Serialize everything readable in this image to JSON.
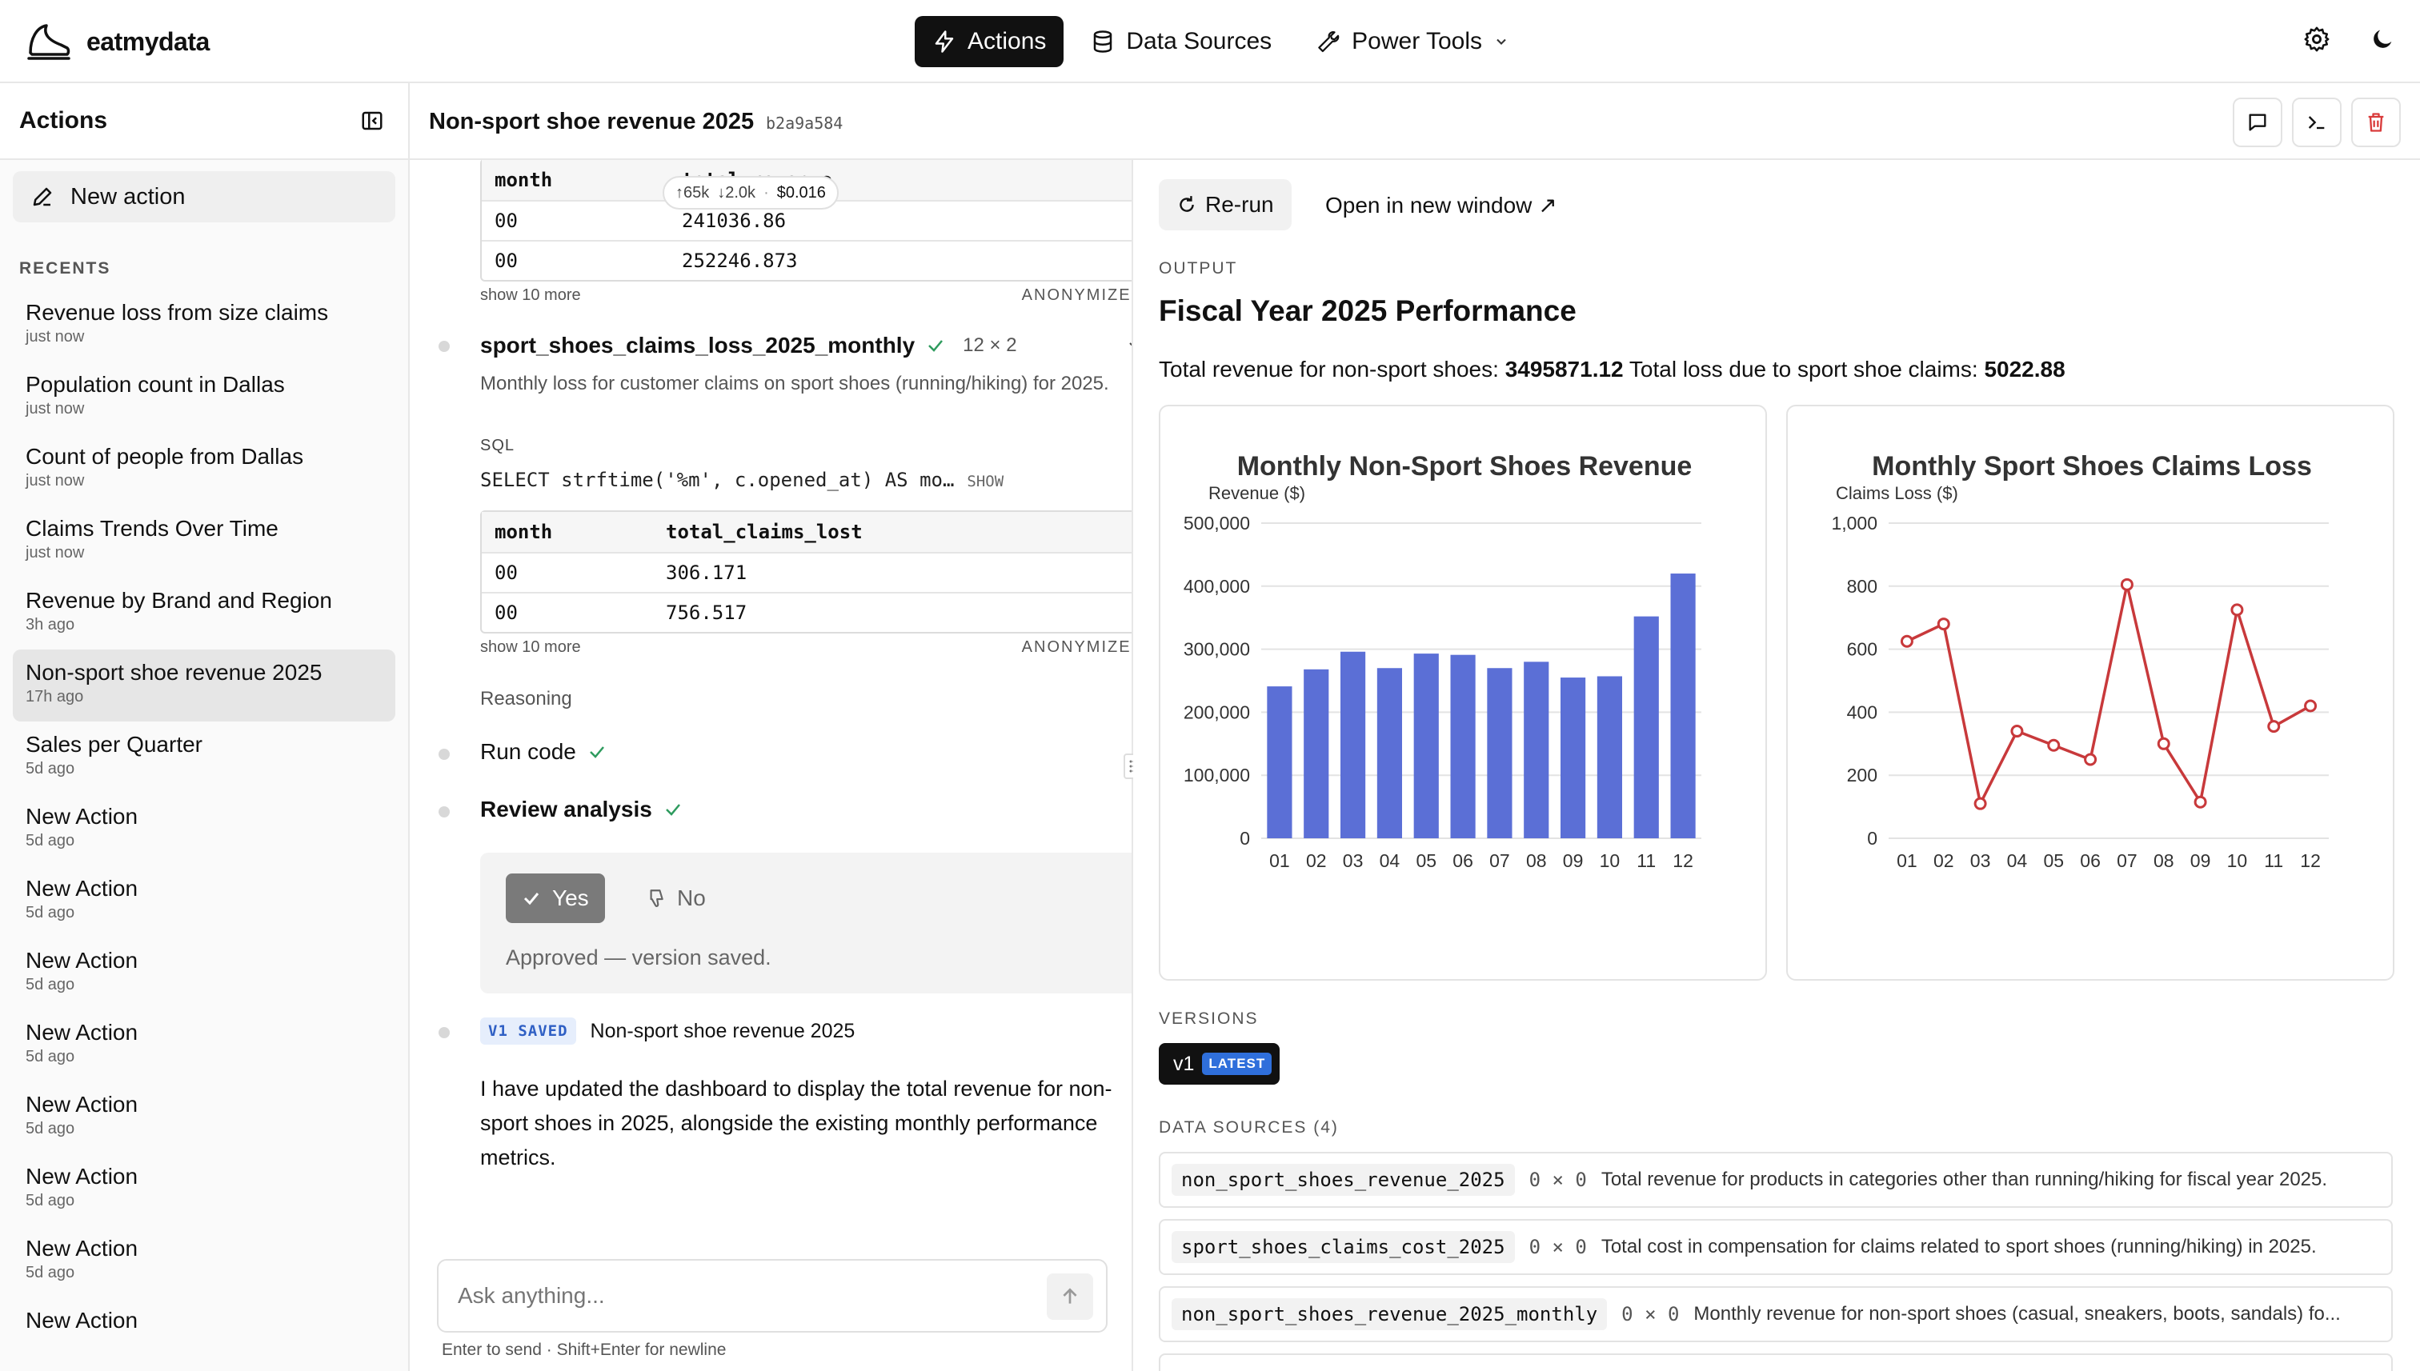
{
  "app": {
    "name": "eatmydata"
  },
  "nav": {
    "actions": "Actions",
    "data_sources": "Data Sources",
    "power_tools": "Power Tools"
  },
  "sidebar": {
    "title": "Actions",
    "new_action": "New action",
    "recents_label": "RECENTS",
    "items": [
      {
        "title": "Revenue loss from size claims",
        "time": "just now"
      },
      {
        "title": "Population count in Dallas",
        "time": "just now"
      },
      {
        "title": "Count of people from Dallas",
        "time": "just now"
      },
      {
        "title": "Claims Trends Over Time",
        "time": "just now"
      },
      {
        "title": "Revenue by Brand and Region",
        "time": "3h ago"
      },
      {
        "title": "Non-sport shoe revenue 2025",
        "time": "17h ago",
        "active": true
      },
      {
        "title": "Sales per Quarter",
        "time": "5d ago"
      },
      {
        "title": "New Action",
        "time": "5d ago"
      },
      {
        "title": "New Action",
        "time": "5d ago"
      },
      {
        "title": "New Action",
        "time": "5d ago"
      },
      {
        "title": "New Action",
        "time": "5d ago"
      },
      {
        "title": "New Action",
        "time": "5d ago"
      },
      {
        "title": "New Action",
        "time": "5d ago"
      },
      {
        "title": "New Action",
        "time": "5d ago"
      },
      {
        "title": "New Action",
        "time": ""
      }
    ]
  },
  "action": {
    "title": "Non-sport shoe revenue 2025",
    "id": "b2a9a584"
  },
  "chat": {
    "table1": {
      "headers": [
        "month",
        "total_revenue"
      ],
      "rows": [
        [
          "00",
          "241036.86"
        ],
        [
          "00",
          "252246.873"
        ]
      ],
      "show_more": "show 10 more",
      "anonymized": "ANONYMIZED"
    },
    "token_badge": {
      "up": "↑65k",
      "down": "↓2.0k",
      "cost": "$0.016"
    },
    "query2": {
      "name": "sport_shoes_claims_loss_2025_monthly",
      "dims": "12 × 2",
      "description": "Monthly loss for customer claims on sport shoes (running/hiking) for 2025.",
      "sql_label": "SQL",
      "sql": "SELECT strftime('%m', c.opened_at) AS mo…",
      "show": "SHOW"
    },
    "table2": {
      "headers": [
        "month",
        "total_claims_lost"
      ],
      "rows": [
        [
          "00",
          "306.171"
        ],
        [
          "00",
          "756.517"
        ]
      ],
      "show_more": "show 10 more",
      "anonymized": "ANONYMIZED"
    },
    "reasoning": "Reasoning",
    "run_code": "Run code",
    "review": "Review analysis",
    "yes": "Yes",
    "no": "No",
    "approved": "Approved — version saved.",
    "saved_badge": "V1 SAVED",
    "saved_title": "Non-sport shoe revenue 2025",
    "message": "I have updated the dashboard to display the total revenue for non-sport shoes in 2025, alongside the existing monthly performance metrics.",
    "input_placeholder": "Ask anything...",
    "hint": "Enter to send · Shift+Enter for newline"
  },
  "output": {
    "rerun": "Re-run",
    "open_new": "Open in new window ↗",
    "label": "OUTPUT",
    "title": "Fiscal Year 2025 Performance",
    "summary_pre1": "Total revenue for non-sport shoes: ",
    "summary_val1": "3495871.12",
    "summary_pre2": " Total loss due to sport shoe claims: ",
    "summary_val2": "5022.88",
    "versions_label": "VERSIONS",
    "version": "v1",
    "version_tag": "LATEST",
    "data_sources_label": "DATA SOURCES (4)",
    "data_sources": [
      {
        "name": "non_sport_shoes_revenue_2025",
        "dims": "0 × 0",
        "desc": "Total revenue for products in categories other than running/hiking for fiscal year 2025."
      },
      {
        "name": "sport_shoes_claims_cost_2025",
        "dims": "0 × 0",
        "desc": "Total cost in compensation for claims related to sport shoes (running/hiking) in 2025."
      },
      {
        "name": "non_sport_shoes_revenue_2025_monthly",
        "dims": "0 × 0",
        "desc": "Monthly revenue for non-sport shoes (casual, sneakers, boots, sandals) fo..."
      }
    ]
  },
  "colors": {
    "bar": "#5b6fd6",
    "line": "#c8393b",
    "accent": "#2f6fdb"
  },
  "chart_data": [
    {
      "type": "bar",
      "title": "Monthly Non-Sport Shoes Revenue",
      "ylabel": "Revenue ($)",
      "categories": [
        "01",
        "02",
        "03",
        "04",
        "05",
        "06",
        "07",
        "08",
        "09",
        "10",
        "11",
        "12"
      ],
      "values": [
        241000,
        268000,
        296000,
        270000,
        293000,
        291000,
        270000,
        280000,
        255000,
        257000,
        352000,
        420000
      ],
      "ylim": [
        0,
        500000
      ],
      "yticks": [
        "0",
        "100,000",
        "200,000",
        "300,000",
        "400,000",
        "500,000"
      ],
      "grid": true
    },
    {
      "type": "line",
      "title": "Monthly Sport Shoes Claims Loss",
      "ylabel": "Claims Loss ($)",
      "categories": [
        "01",
        "02",
        "03",
        "04",
        "05",
        "06",
        "07",
        "08",
        "09",
        "10",
        "11",
        "12"
      ],
      "values": [
        625,
        680,
        110,
        340,
        295,
        250,
        805,
        300,
        115,
        725,
        355,
        420
      ],
      "ylim": [
        0,
        1000
      ],
      "yticks": [
        "0",
        "200",
        "400",
        "600",
        "800",
        "1,000"
      ],
      "grid": true
    }
  ]
}
